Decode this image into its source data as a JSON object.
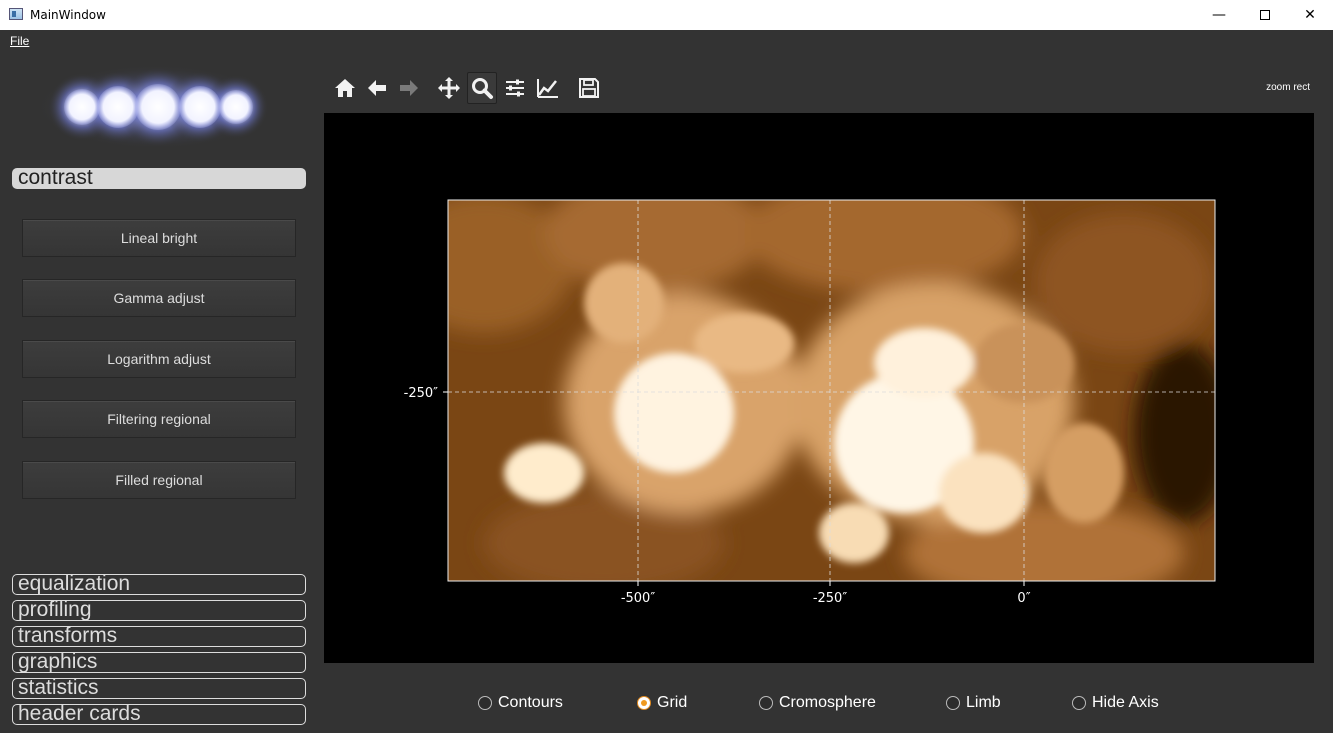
{
  "window": {
    "title": "MainWindow",
    "minimize_glyph": "—",
    "close_glyph": "✕"
  },
  "menu": {
    "file_label": "File"
  },
  "sidebar": {
    "active_section": "contrast",
    "contrast_buttons": [
      "Lineal bright",
      "Gamma adjust",
      "Logarithm adjust",
      "Filtering regional",
      "Filled regional"
    ],
    "sections": [
      "equalization",
      "profiling",
      "transforms",
      "graphics",
      "statistics",
      "header cards"
    ]
  },
  "toolbar": {
    "icons": [
      "home-icon",
      "back-arrow-icon",
      "forward-arrow-icon",
      "pan-icon",
      "zoom-icon",
      "subplots-icon",
      "customize-icon",
      "save-icon"
    ],
    "active_tool": "zoom-icon",
    "mode_label": "zoom rect"
  },
  "plot": {
    "x_ticks": [
      "-500″",
      "-250″",
      "0″"
    ],
    "y_ticks": [
      "-250″"
    ],
    "colormap": "sdoaia171",
    "grid": true,
    "grid_color": "#dddddd",
    "image_base_color": "#7a4614",
    "image_highlight_color": "#fff6e6"
  },
  "options": {
    "radios": [
      {
        "label": "Contours",
        "checked": false
      },
      {
        "label": "Grid",
        "checked": true
      },
      {
        "label": "Cromosphere",
        "checked": false
      },
      {
        "label": "Limb",
        "checked": false
      },
      {
        "label": "Hide Axis",
        "checked": false
      }
    ]
  }
}
